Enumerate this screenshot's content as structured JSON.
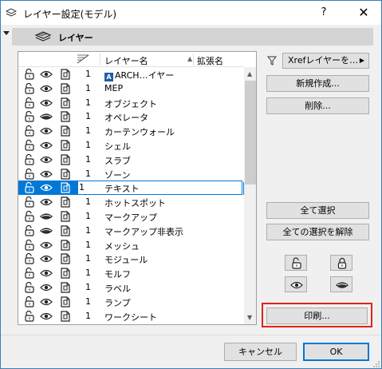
{
  "window": {
    "title": "レイヤー設定(モデル)",
    "help_label": "?",
    "close_label": "✕"
  },
  "section": {
    "title": "レイヤー"
  },
  "list": {
    "headers": {
      "name": "レイヤー名",
      "ext": "拡張名"
    },
    "rows": [
      {
        "pen": "1",
        "name": "ARCH…イヤー",
        "badge": "A",
        "visible": true
      },
      {
        "pen": "1",
        "name": "MEP",
        "visible": true
      },
      {
        "pen": "1",
        "name": "オブジェクト",
        "visible": true
      },
      {
        "pen": "1",
        "name": "オペレータ",
        "visible": false
      },
      {
        "pen": "1",
        "name": "カーテンウォール",
        "visible": true
      },
      {
        "pen": "1",
        "name": "シェル",
        "visible": true
      },
      {
        "pen": "1",
        "name": "スラブ",
        "visible": true
      },
      {
        "pen": "1",
        "name": "ゾーン",
        "visible": true
      },
      {
        "pen": "1",
        "name": "テキスト",
        "visible": true,
        "selected": true
      },
      {
        "pen": "1",
        "name": "ホットスポット",
        "visible": true
      },
      {
        "pen": "1",
        "name": "マークアップ",
        "visible": false
      },
      {
        "pen": "1",
        "name": "マークアップ非表示",
        "visible": false
      },
      {
        "pen": "1",
        "name": "メッシュ",
        "visible": true
      },
      {
        "pen": "1",
        "name": "モジュール",
        "visible": true
      },
      {
        "pen": "1",
        "name": "モルフ",
        "visible": true
      },
      {
        "pen": "1",
        "name": "ラベル",
        "visible": true
      },
      {
        "pen": "1",
        "name": "ランプ",
        "visible": true
      },
      {
        "pen": "1",
        "name": "ワークシート",
        "visible": true
      }
    ]
  },
  "side": {
    "filter_label": "Xrefレイヤーを…",
    "new_label": "新規作成...",
    "delete_label": "削除...",
    "select_all_label": "全て選択",
    "deselect_all_label": "全ての選択を解除",
    "print_label": "印刷..."
  },
  "footer": {
    "cancel_label": "キャンセル",
    "ok_label": "OK"
  },
  "colors": {
    "accent": "#0078d7",
    "highlight": "#e0231d"
  }
}
